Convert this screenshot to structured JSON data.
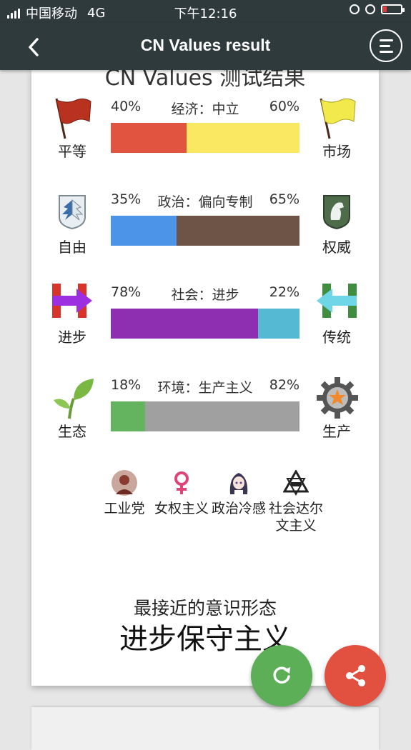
{
  "status_bar": {
    "carrier": "中国移动",
    "network": "4G",
    "time": "下午12:16"
  },
  "app_bar": {
    "title": "CN Values result"
  },
  "card": {
    "title": "CN Values 测试结果",
    "axes": [
      {
        "axis_label": "经济：中立",
        "left_label": "平等",
        "right_label": "市场",
        "left_pct_text": "40%",
        "right_pct_text": "60%",
        "left_value": 40,
        "right_value": 60,
        "left_color": "#e05440",
        "right_color": "#fbe862",
        "left_icon": "red-flag-icon",
        "right_icon": "yellow-flag-icon"
      },
      {
        "axis_label": "政治：偏向专制",
        "left_label": "自由",
        "right_label": "权威",
        "left_pct_text": "35%",
        "right_pct_text": "65%",
        "left_value": 35,
        "right_value": 65,
        "left_color": "#4b94e7",
        "right_color": "#6d5446",
        "left_icon": "wings-emblem-icon",
        "right_icon": "horse-emblem-icon"
      },
      {
        "axis_label": "社会：进步",
        "left_label": "进步",
        "right_label": "传统",
        "left_pct_text": "78%",
        "right_pct_text": "22%",
        "left_value": 78,
        "right_value": 22,
        "left_color": "#8e2fb1",
        "right_color": "#55b9d4",
        "left_icon": "h-arrow-right-icon",
        "right_icon": "h-arrow-left-icon"
      },
      {
        "axis_label": "环境：生产主义",
        "left_label": "生态",
        "right_label": "生产",
        "left_pct_text": "18%",
        "right_pct_text": "82%",
        "left_value": 18,
        "right_value": 82,
        "left_color": "#64b35e",
        "right_color": "#a0a0a0",
        "left_icon": "sprout-icon",
        "right_icon": "gear-star-icon"
      }
    ],
    "tags": [
      {
        "label": "工业党",
        "icon": "portrait-icon"
      },
      {
        "label": "女权主义",
        "icon": "female-symbol-icon"
      },
      {
        "label": "政治冷感",
        "icon": "anime-girl-icon"
      },
      {
        "label": "社会达尔文主义",
        "icon": "triangle-emblem-icon"
      }
    ],
    "closest_label": "最接近的意识形态",
    "closest_ideology": "进步保守主义"
  },
  "fabs": {
    "refresh_icon": "refresh-icon",
    "share_icon": "share-icon",
    "refresh_color": "#5caf57",
    "share_color": "#e25040"
  }
}
